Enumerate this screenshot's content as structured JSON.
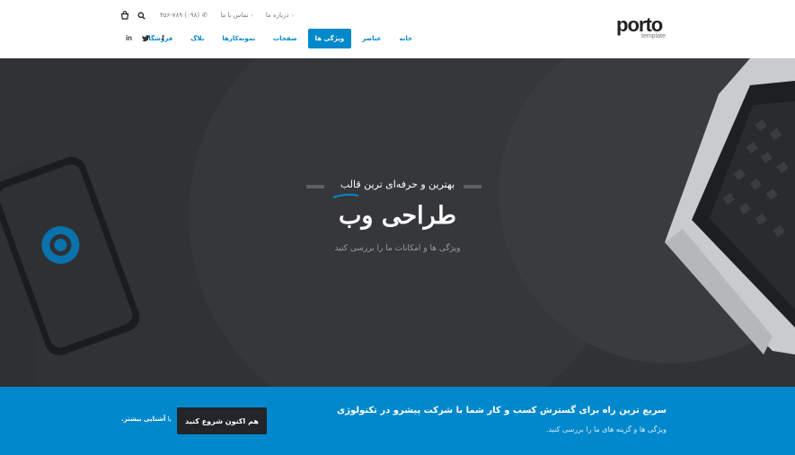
{
  "header": {
    "logo": {
      "word": "porto",
      "sub": "template"
    },
    "topbar": [
      {
        "label": "درباره ما"
      },
      {
        "label": "تماس با ما"
      }
    ],
    "phone": "(۰۹۸) ۴۵۶-۷۸۹",
    "nav": [
      {
        "label": "خانه",
        "active": false
      },
      {
        "label": "عناصر",
        "active": false
      },
      {
        "label": "ویژگی ها",
        "active": true
      },
      {
        "label": "صفحات",
        "active": false
      },
      {
        "label": "نمونه‌کارها",
        "active": false
      },
      {
        "label": "بلاگ",
        "active": false
      },
      {
        "label": "فروشگاه",
        "active": false
      }
    ],
    "socials": [
      "f",
      "t",
      "in"
    ]
  },
  "hero": {
    "pre": "بهترین و حرفه‌ای ترین قالب",
    "title": "طراحی وب",
    "sub": "ویژگی ها و امکانات ما را بررسی کنید"
  },
  "cta": {
    "title": "سریع ترین راه برای گسترش کسب و کار شما با شرکت پیشرو در تکنولوژی",
    "sub": "ویژگی ها و گزینه های ما را بررسی کنید.",
    "button": "هم اکنون شروع کنید",
    "more_prefix": "یا",
    "more_link": "آشنایی بیشتر."
  },
  "colors": {
    "primary": "#0088cc",
    "dark": "#222529",
    "hero_bg": "#303234"
  }
}
